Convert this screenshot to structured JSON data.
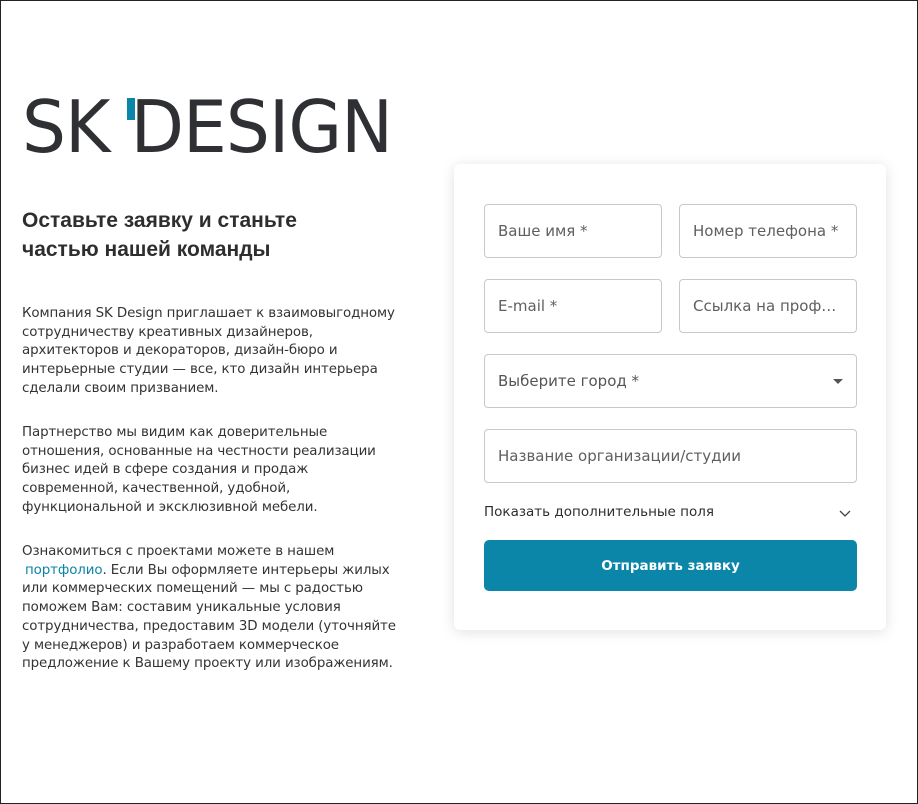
{
  "brand": {
    "logo_text": "SK DESIGN",
    "colors": {
      "dark": "#2e3033",
      "accent": "#0b86a8"
    }
  },
  "intro": {
    "heading": "Оставьте заявку и станьте частью нашей команды",
    "paragraph1": "Компания SK Design приглашает к взаимовыгодному сотрудничеству креативных дизайнеров, архитекторов и декораторов, дизайн-бюро и интерьерные студии — все, кто дизайн интерьера сделали своим призванием.",
    "paragraph2": "Партнерство мы видим как доверительные отношения, основанные на честности реализации бизнес идей в сфере создания и продаж современной, качественной, удобной, функциональной и эксклюзивной мебели.",
    "paragraph3_before": "Ознакомиться с проектами можете в нашем",
    "portfolio_link": "портфолио",
    "paragraph3_after": ". Если Вы оформляете интерьеры жилых или коммерческих помещений — мы с радостью поможем Вам: составим уникальные условия сотрудничества, предоставим 3D модели (уточняйте у менеджеров) и разработаем коммерческое предложение к Вашему проекту или изображениям."
  },
  "form": {
    "name_placeholder": "Ваше имя *",
    "phone_placeholder": "Номер телефона *",
    "email_placeholder": "E-mail *",
    "profile_link_placeholder": "Ссылка на профиль",
    "city_select": "Выберите город *",
    "org_placeholder": "Название организации/студии",
    "more_fields": "Показать дополнительные поля",
    "submit_label": "Отправить заявку",
    "icons": {
      "city": "caret-down-icon",
      "more": "chevron-down-icon"
    }
  }
}
